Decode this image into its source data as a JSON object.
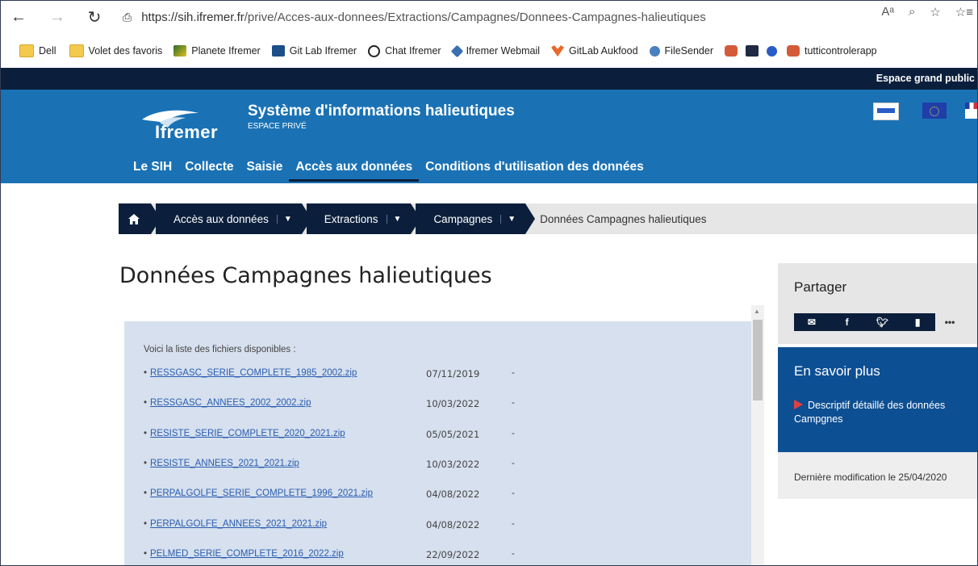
{
  "browser": {
    "url_domain": "https://sih.ifremer.fr",
    "url_path": "/prive/Acces-aux-donnees/Extractions/Campagnes/Donnees-Campagnes-halieutiques",
    "bookmarks": [
      "Dell",
      "Volet des favoris",
      "Planete Ifremer",
      "Git Lab Ifremer",
      "Chat Ifremer",
      "Ifremer Webmail",
      "GitLab Aukfood",
      "FileSender",
      "tutticontrolerapp"
    ]
  },
  "site": {
    "topstrip": "Espace grand public",
    "logo": "Ifremer",
    "title": "Système d'informations halieutiques",
    "subtitle": "ESPACE PRIVÉ",
    "nav": [
      "Le SIH",
      "Collecte",
      "Saisie",
      "Accès aux données",
      "Conditions d'utilisation des données"
    ]
  },
  "breadcrumb": {
    "items": [
      "Accès aux données",
      "Extractions",
      "Campagnes"
    ],
    "current": "Données Campagnes halieutiques"
  },
  "page": {
    "title": "Données Campagnes halieutiques",
    "intro": "Voici la liste des fichiers disponibles :",
    "files": [
      {
        "name": "RESSGASC_SERIE_COMPLETE_1985_2002.zip",
        "date": "07/11/2019",
        "size": "-"
      },
      {
        "name": "RESSGASC_ANNEES_2002_2002.zip",
        "date": "10/03/2022",
        "size": "-"
      },
      {
        "name": "RESISTE_SERIE_COMPLETE_2020_2021.zip",
        "date": "05/05/2021",
        "size": "-"
      },
      {
        "name": "RESISTE_ANNEES_2021_2021.zip",
        "date": "10/03/2022",
        "size": "-"
      },
      {
        "name": "PERPALGOLFE_SERIE_COMPLETE_1996_2021.zip",
        "date": "04/08/2022",
        "size": "-"
      },
      {
        "name": "PERPALGOLFE_ANNEES_2021_2021.zip",
        "date": "04/08/2022",
        "size": "-"
      },
      {
        "name": "PELMED_SERIE_COMPLETE_2016_2022.zip",
        "date": "22/09/2022",
        "size": "-"
      }
    ]
  },
  "sidebar": {
    "share_title": "Partager",
    "more_title": "En savoir plus",
    "doc_link": "Descriptif détaillé des données Campgnes",
    "last_modified": "Dernière modification le 25/04/2020"
  }
}
